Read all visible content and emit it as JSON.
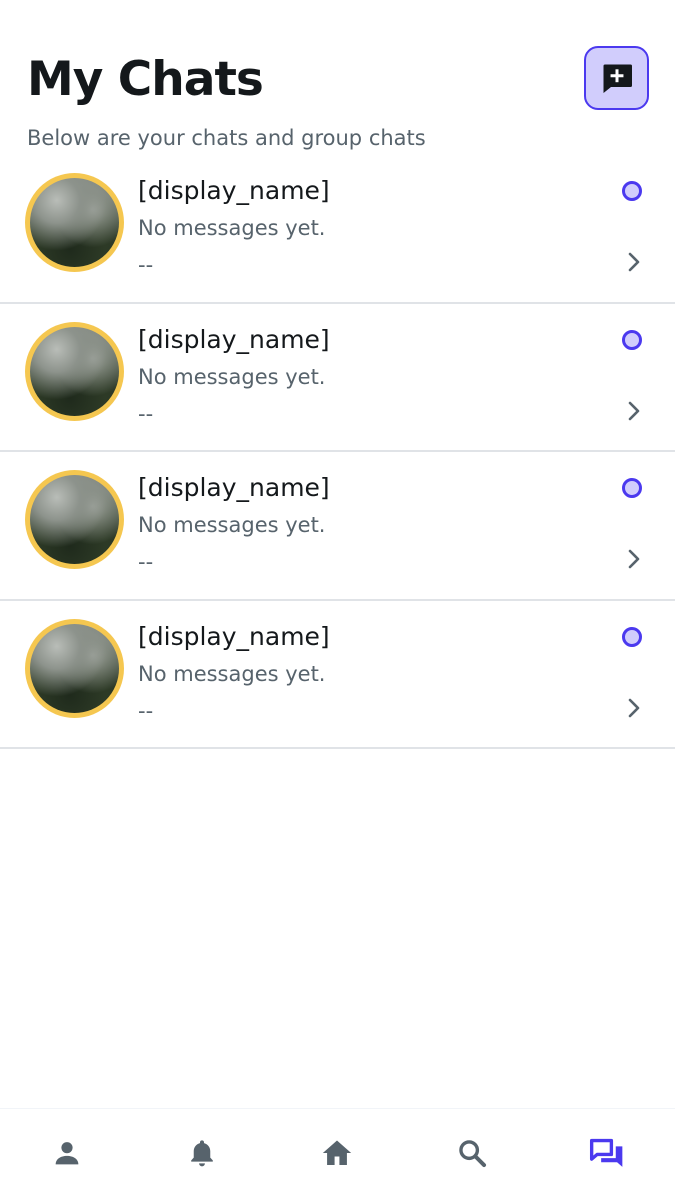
{
  "header": {
    "title": "My Chats",
    "subtitle": "Below are your chats and group chats",
    "new_chat_icon": "add-comment-icon"
  },
  "chats": [
    {
      "name": "[display_name]",
      "preview": "No messages yet.",
      "time": "--",
      "unread": true
    },
    {
      "name": "[display_name]",
      "preview": "No messages yet.",
      "time": "--",
      "unread": true
    },
    {
      "name": "[display_name]",
      "preview": "No messages yet.",
      "time": "--",
      "unread": true
    },
    {
      "name": "[display_name]",
      "preview": "No messages yet.",
      "time": "--",
      "unread": true
    }
  ],
  "nav": {
    "items": [
      {
        "icon": "person-icon",
        "active": false
      },
      {
        "icon": "bell-icon",
        "active": false
      },
      {
        "icon": "home-icon",
        "active": false
      },
      {
        "icon": "search-icon",
        "active": false
      },
      {
        "icon": "chats-icon",
        "active": true
      }
    ]
  },
  "colors": {
    "accent": "#4b39ef",
    "accent_light": "#d1cdfc",
    "avatar_ring": "#f5c750",
    "primary_text": "#14181b",
    "secondary_text": "#57636c",
    "divider": "#e0e3e7",
    "nav_inactive": "#57636c"
  }
}
